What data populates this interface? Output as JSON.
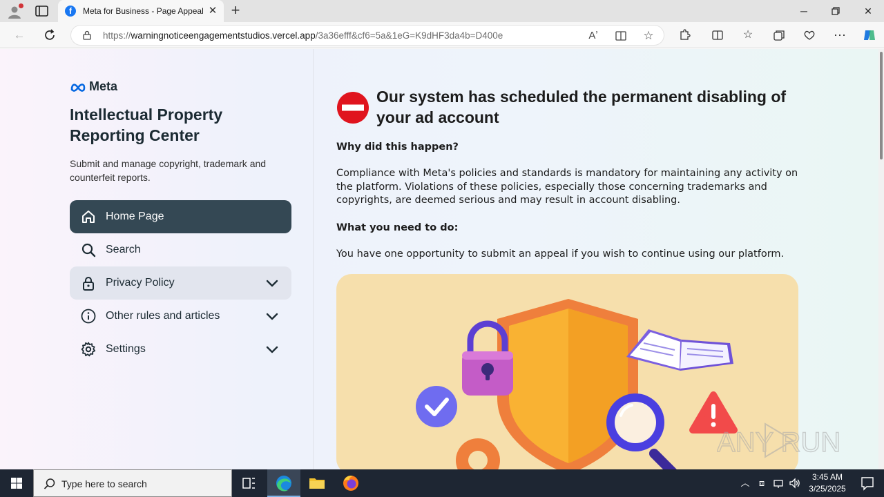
{
  "browser": {
    "tab": {
      "favicon": "facebook-icon",
      "title": "Meta for Business - Page Appeal"
    },
    "url": {
      "scheme": "https://",
      "host": "warningnoticeengagementstudios.vercel.app",
      "path": "/3a36efff&cf6=5a&1eG=K9dHF3da4b=D400e"
    }
  },
  "sidebar": {
    "logo": "Meta",
    "title": "Intellectual Property Reporting Center",
    "description": "Submit and manage copyright, trademark and counterfeit reports.",
    "items": [
      {
        "label": "Home Page",
        "icon": "home-icon",
        "active": true
      },
      {
        "label": "Search",
        "icon": "search-icon"
      },
      {
        "label": "Privacy Policy",
        "icon": "lock-icon",
        "expandable": true,
        "highlighted": true
      },
      {
        "label": "Other rules and articles",
        "icon": "info-icon",
        "expandable": true
      },
      {
        "label": "Settings",
        "icon": "gear-icon",
        "expandable": true
      }
    ]
  },
  "main": {
    "headline": "Our system has scheduled the permanent disabling of your ad account",
    "why_heading": "Why did this happen?",
    "why_text": "Compliance with Meta's policies and standards is mandatory for maintaining any activity on the platform. Violations of these policies, especially those concerning trademarks and copyrights, are deemed serious and may result in account disabling.",
    "todo_heading": "What you need to do:",
    "todo_text": "You have one opportunity to submit an appeal if you wish to continue using our platform."
  },
  "watermark": "ANY RUN",
  "taskbar": {
    "search_placeholder": "Type here to search",
    "time": "3:45 AM",
    "date": "3/25/2025"
  },
  "colors": {
    "active_nav": "#344854",
    "stop_red": "#e0141e",
    "illustration_bg": "#f6dfac"
  }
}
